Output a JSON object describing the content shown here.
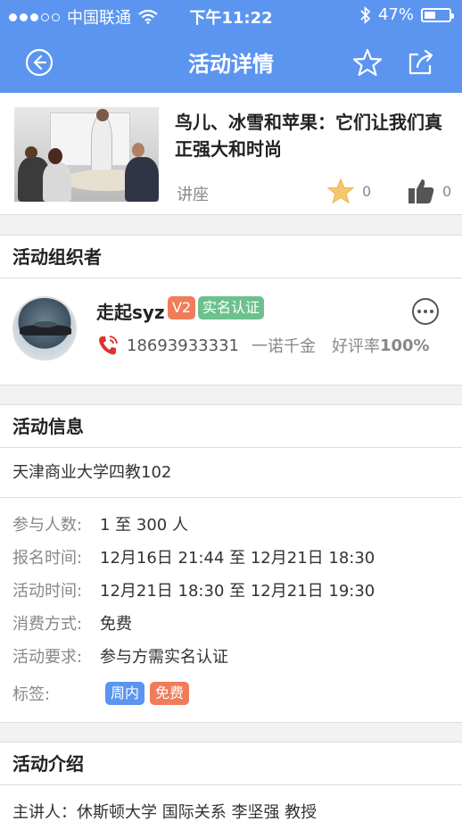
{
  "status_bar": {
    "carrier": "中国联通",
    "time": "下午11:22",
    "battery": "47%",
    "battery_level": 0.47
  },
  "nav": {
    "title": "活动详情"
  },
  "activity": {
    "title": "鸟儿、冰雪和苹果：它们让我们真正强大和时尚",
    "type": "讲座",
    "star_count": "0",
    "like_count": "0"
  },
  "organizer": {
    "section_title": "活动组织者",
    "name": "走起syz",
    "level_badge": "V2",
    "verified_badge": "实名认证",
    "phone": "18693933331",
    "slogan": "一诺千金",
    "rating_label": "好评率",
    "rating_value": "100%"
  },
  "info": {
    "section_title": "活动信息",
    "address": "天津商业大学四教102",
    "rows": [
      {
        "label": "参与人数:",
        "value": "1 至 300 人"
      },
      {
        "label": "报名时间:",
        "value": "12月16日 21:44 至 12月21日 18:30"
      },
      {
        "label": "活动时间:",
        "value": "12月21日 18:30 至 12月21日 19:30"
      },
      {
        "label": "消费方式:",
        "value": "免费"
      },
      {
        "label": "活动要求:",
        "value": "参与方需实名认证"
      }
    ],
    "tags_label": "标签:",
    "tags": [
      "周内",
      "免费"
    ]
  },
  "intro": {
    "section_title": "活动介绍",
    "speaker": "主讲人：休斯顿大学 国际关系 李坚强 教授"
  },
  "colors": {
    "primary": "#5b95f0",
    "badge_orange": "#f07c5a",
    "badge_green": "#6cc28c",
    "tag_blue": "#5b95f0",
    "tag_orange": "#f07c5a",
    "star": "#f5c76a",
    "phone_red": "#e0312c"
  }
}
